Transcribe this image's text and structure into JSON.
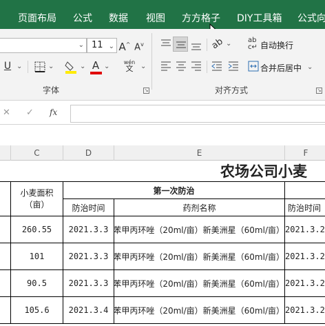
{
  "ribbon_tabs": [
    "页面布局",
    "公式",
    "数据",
    "视图",
    "方方格子",
    "DIY工具箱",
    "公式向"
  ],
  "font": {
    "name": "",
    "size": "11",
    "group_label": "字体"
  },
  "alignment": {
    "wrap_label": "自动换行",
    "merge_label": "合并后居中",
    "group_label": "对齐方式"
  },
  "formula_bar": {
    "cancel_icon": "✕",
    "enter_icon": "✓",
    "fx_label": "fx",
    "content": ""
  },
  "columns": [
    "C",
    "D",
    "E",
    "F"
  ],
  "sheet": {
    "title": "农场公司小麦",
    "header_area": "小麦面积\n（亩）",
    "header_first": "第一次防治",
    "header_time": "防治时间",
    "header_drug": "药剂名称",
    "header_time_f": "防治时间",
    "rows": [
      {
        "area": "260.55",
        "date": "2021.3.3",
        "drug": "苯甲丙环唑（20ml/亩）新美洲星（60ml/亩）",
        "date_f": "2021.3.2"
      },
      {
        "area": "101",
        "date": "2021.3.3",
        "drug": "苯甲丙环唑（20ml/亩）新美洲星（60ml/亩）",
        "date_f": "2021.3.2"
      },
      {
        "area": "90.5",
        "date": "2021.3.3",
        "drug": "苯甲丙环唑（20ml/亩）新美洲星（60ml/亩）",
        "date_f": "2021.3.2"
      },
      {
        "area": "105.6",
        "date": "2021.3.4",
        "drug": "苯甲丙环唑（20ml/亩）新美洲星（60ml/亩）",
        "date_f": "2021.3.2"
      }
    ]
  }
}
